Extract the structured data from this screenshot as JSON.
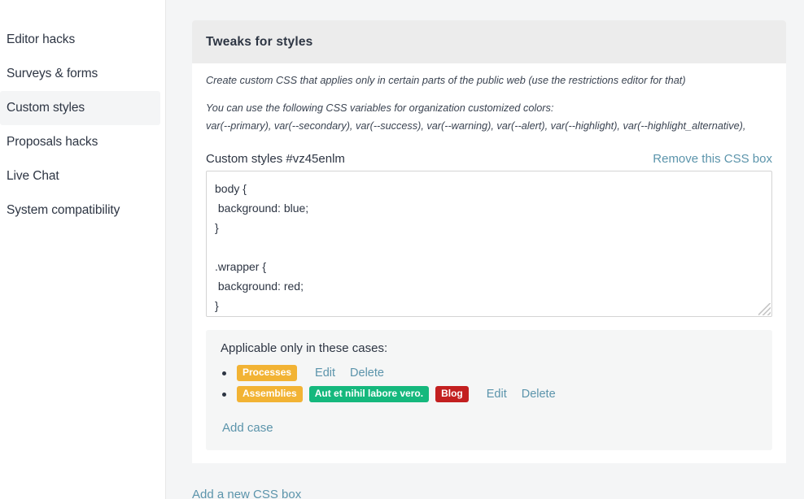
{
  "sidebar": {
    "items": [
      {
        "label": "Editor hacks",
        "active": false
      },
      {
        "label": "Surveys & forms",
        "active": false
      },
      {
        "label": "Custom styles",
        "active": true
      },
      {
        "label": "Proposals hacks",
        "active": false
      },
      {
        "label": "Live Chat",
        "active": false
      },
      {
        "label": "System compatibility",
        "active": false
      }
    ]
  },
  "card": {
    "title": "Tweaks for styles",
    "help_line_1": "Create custom CSS that applies only in certain parts of the public web (use the restrictions editor for that)",
    "help_line_2": "You can use the following CSS variables for organization customized colors:",
    "help_line_3": "var(--primary), var(--secondary), var(--success), var(--warning), var(--alert), var(--highlight), var(--highlight_alternative),"
  },
  "css_box": {
    "label": "Custom styles #vz45enlm",
    "remove_label": "Remove this CSS box",
    "value": "body {\n background: blue;\n}\n\n.wrapper {\n background: red;\n}",
    "placeholder": ""
  },
  "cases": {
    "title": "Applicable only in these cases:",
    "items": [
      {
        "badges": [
          {
            "text": "Processes",
            "color": "#f2b334",
            "variant": "badge-amber"
          }
        ],
        "edit_label": "Edit",
        "delete_label": "Delete"
      },
      {
        "badges": [
          {
            "text": "Assemblies",
            "color": "#f2b334",
            "variant": "badge-amber"
          },
          {
            "text": "Aut et nihil labore vero.",
            "color": "#15b87d",
            "variant": "badge-green"
          },
          {
            "text": "Blog",
            "color": "#c32020",
            "variant": "badge-red"
          }
        ],
        "edit_label": "Edit",
        "delete_label": "Delete"
      }
    ],
    "add_label": "Add case"
  },
  "footer": {
    "add_new_css_box": "Add a new CSS box"
  },
  "colors": {
    "link": "#5b94ab",
    "text": "#2d3543",
    "card_header_bg": "#ececec",
    "page_bg": "#f4f5f6",
    "panel_bg": "#f5f6f6"
  }
}
